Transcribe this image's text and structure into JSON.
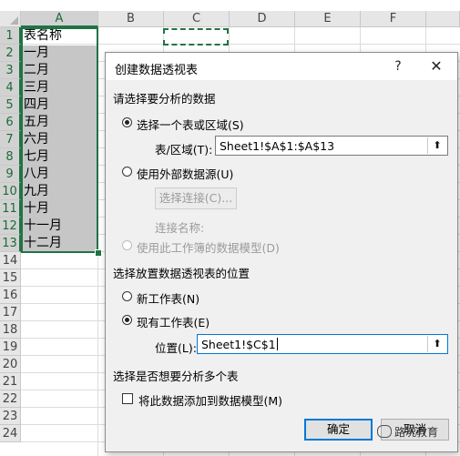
{
  "spreadsheet": {
    "columns": [
      "A",
      "B",
      "C",
      "D",
      "E",
      "F"
    ],
    "rows": [
      "1",
      "2",
      "3",
      "4",
      "5",
      "6",
      "7",
      "8",
      "9",
      "10",
      "11",
      "12",
      "13",
      "14",
      "15",
      "16",
      "17",
      "18",
      "19",
      "20",
      "21",
      "22",
      "23",
      "24"
    ],
    "column_a_cells": [
      "表名称",
      "一月",
      "二月",
      "三月",
      "四月",
      "五月",
      "六月",
      "七月",
      "八月",
      "九月",
      "十月",
      "十一月",
      "十二月"
    ],
    "selected_column": "A",
    "selected_range": "A1:A13",
    "copy_marquee_cell": "C1"
  },
  "dialog": {
    "title": "创建数据透视表",
    "help_icon": "?",
    "close_icon": "✕",
    "section_data": "请选择要分析的数据",
    "option_select_range": "选择一个表或区域(S)",
    "range_label": "表/区域(T):",
    "range_value": "Sheet1!$A$1:$A$13",
    "option_external": "使用外部数据源(U)",
    "choose_connection_button": "选择连接(C)...",
    "connection_name_label": "连接名称:",
    "option_data_model": "使用此工作簿的数据模型(D)",
    "section_location": "选择放置数据透视表的位置",
    "option_new_sheet": "新工作表(N)",
    "option_existing_sheet": "现有工作表(E)",
    "location_label": "位置(L):",
    "location_value": "Sheet1!$C$1",
    "section_multiple": "选择是否想要分析多个表",
    "add_to_model_label": "将此数据添加到数据模型(M)",
    "ok_button": "确定",
    "cancel_button": "取消",
    "collapse_icon": "⬆"
  },
  "watermark": {
    "text": "路况教育"
  },
  "colors": {
    "excel_green": "#217346",
    "focus_blue": "#0078d7",
    "selection_gray": "#c6c6c6",
    "dialog_bg": "#f0f0f0"
  }
}
